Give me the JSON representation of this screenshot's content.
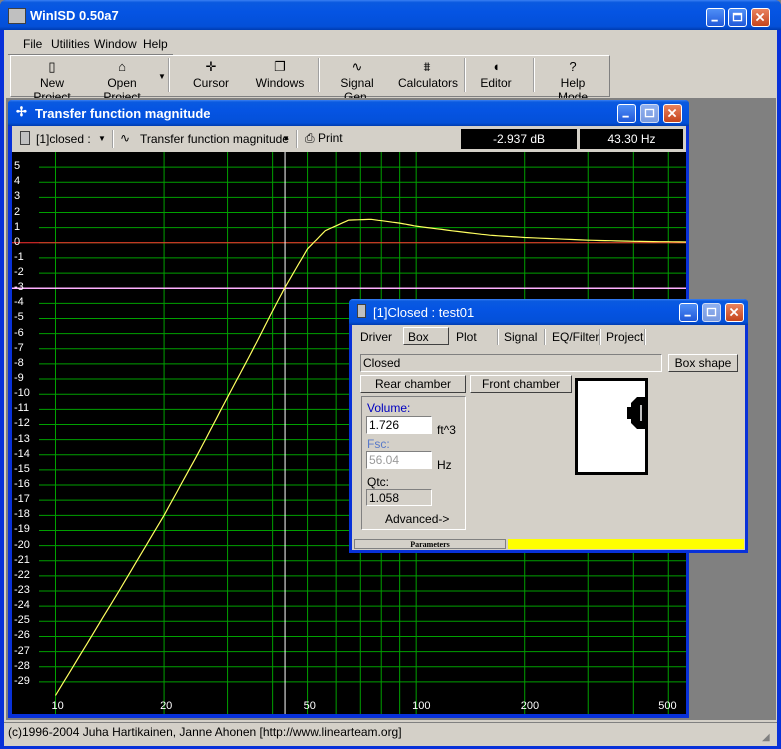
{
  "app": {
    "title": "WinISD 0.50a7"
  },
  "menu": [
    "File",
    "Utilities",
    "Window",
    "Help"
  ],
  "toolbar": [
    {
      "label": "New Project",
      "icon": "new-project-icon"
    },
    {
      "label": "Open Project",
      "icon": "open-folder-icon"
    },
    {
      "label": "Cursor",
      "icon": "cursor-icon"
    },
    {
      "label": "Windows",
      "icon": "windows-icon"
    },
    {
      "label": "Signal Gen.",
      "icon": "sine-wave-icon"
    },
    {
      "label": "Calculators",
      "icon": "calculator-icon"
    },
    {
      "label": "Editor",
      "icon": "speaker-editor-icon"
    },
    {
      "label": "Help Mode",
      "icon": "question-icon"
    }
  ],
  "plot_window": {
    "title": "Transfer function magnitude",
    "project_select": "[1]closed :",
    "graph_select": "Transfer function magnitude",
    "print_label": "Print",
    "readout_db": "-2.937 dB",
    "readout_hz": "43.30 Hz"
  },
  "chart_data": {
    "type": "line",
    "xscale": "log",
    "xlim": [
      9,
      560
    ],
    "ylim": [
      -30,
      5.6
    ],
    "xticks": [
      10,
      20,
      50,
      100,
      200,
      500
    ],
    "yticks": [
      5,
      4,
      3,
      2,
      1,
      0,
      -1,
      -2,
      -3,
      -4,
      -5,
      -6,
      -7,
      -8,
      -9,
      -10,
      -11,
      -12,
      -13,
      -14,
      -15,
      -16,
      -17,
      -18,
      -19,
      -20,
      -21,
      -22,
      -23,
      -24,
      -25,
      -26,
      -27,
      -28,
      -29
    ],
    "grid": true,
    "reference_lines": {
      "zero_db": 0,
      "minus3_db": -3
    },
    "cursor_x": 43.3,
    "series": [
      {
        "color": "#ffff60",
        "x": [
          10,
          15,
          20,
          25,
          30,
          35,
          40,
          43.3,
          50,
          56,
          65,
          75,
          90,
          100,
          130,
          160,
          200,
          300,
          400,
          560
        ],
        "y": [
          -29.9,
          -23.0,
          -18.0,
          -13.8,
          -10.2,
          -7.2,
          -4.5,
          -2.937,
          -0.4,
          0.8,
          1.5,
          1.55,
          1.3,
          1.1,
          0.75,
          0.5,
          0.35,
          0.17,
          0.1,
          0.05
        ]
      }
    ]
  },
  "box_window": {
    "title": "[1]Closed : test01",
    "tabs": [
      "Driver",
      "Box",
      "Plot",
      "Signal",
      "EQ/Filter",
      "Project"
    ],
    "active_tab": "Box",
    "box_type": "Closed",
    "box_shape_button": "Box shape",
    "rear_chamber_button": "Rear chamber",
    "front_chamber_button": "Front chamber",
    "volume_label": "Volume:",
    "volume_value": "1.726",
    "volume_unit": "ft^3",
    "fsc_label": "Fsc:",
    "fsc_value": "56.04",
    "fsc_unit": "Hz",
    "qtc_label": "Qtc:",
    "qtc_value": "1.058",
    "advanced_label": "Advanced->",
    "status_label": "Parameters"
  },
  "status_bar": "(c)1996-2004 Juha Hartikainen, Janne Ahonen [http://www.linearteam.org]"
}
